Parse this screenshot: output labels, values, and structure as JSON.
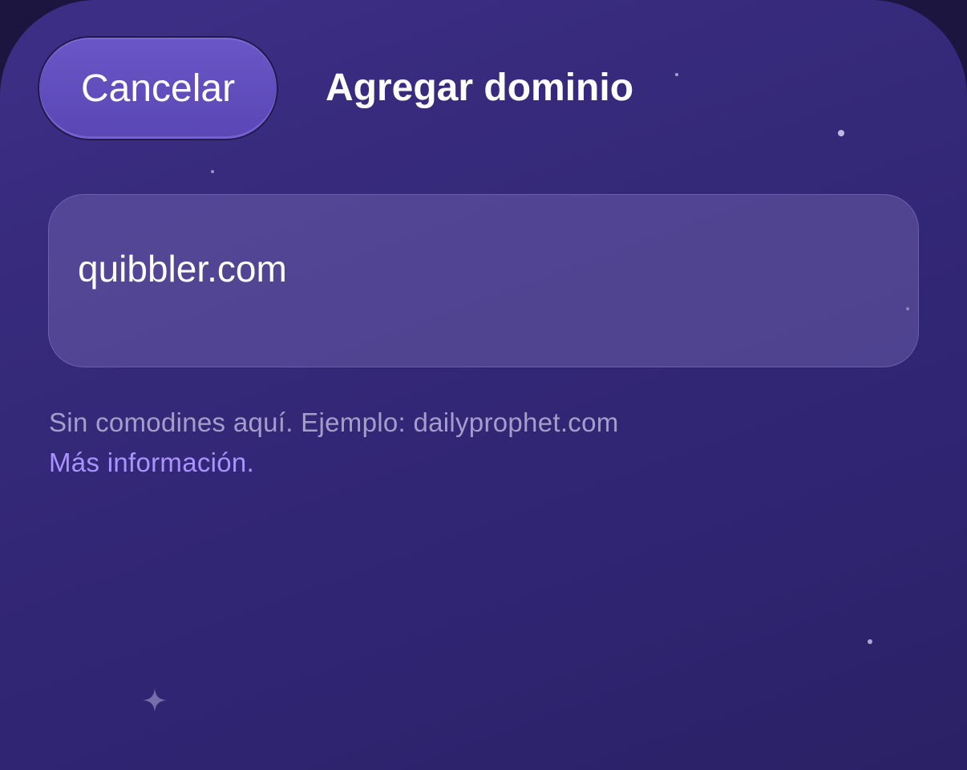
{
  "header": {
    "cancel_label": "Cancelar",
    "title": "Agregar dominio"
  },
  "domain_input": {
    "value": "quibbler.com"
  },
  "help": {
    "hint_text": "Sin comodines aquí. Ejemplo: dailyprophet.com",
    "more_info_label": "Más información."
  },
  "colors": {
    "background": "#342878",
    "cancel_button": "#5f4bbb",
    "link": "#a893ff",
    "hint_text": "#a59dcb"
  },
  "icons": {
    "sparkle": "sparkle-icon"
  }
}
